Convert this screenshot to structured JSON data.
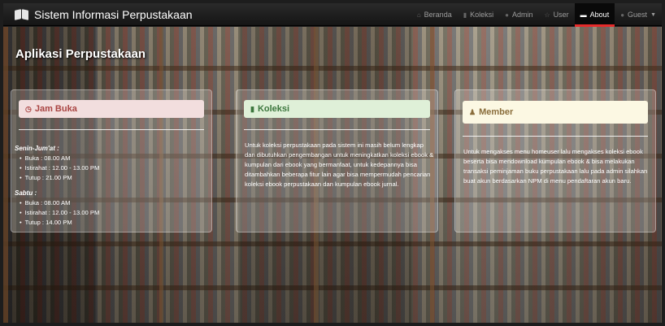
{
  "navbar": {
    "brand": "Sistem Informasi Perpustakaan",
    "items": [
      {
        "label": "Beranda",
        "icon": "home-icon",
        "glyph": "⌂",
        "active": false
      },
      {
        "label": "Koleksi",
        "icon": "book-icon",
        "glyph": "▮",
        "active": false
      },
      {
        "label": "Admin",
        "icon": "user-icon",
        "glyph": "●",
        "active": false
      },
      {
        "label": "User",
        "icon": "star-icon",
        "glyph": "☆",
        "active": false
      },
      {
        "label": "About",
        "icon": "briefcase-icon",
        "glyph": "▬",
        "active": true
      },
      {
        "label": "Guest",
        "icon": "user-icon",
        "glyph": "●",
        "active": false,
        "dropdown": true
      }
    ],
    "active_underline_color": "#e52a2a"
  },
  "hero": {
    "title": "Aplikasi Perpustakaan"
  },
  "cards": {
    "jam_buka": {
      "title": "Jam Buka",
      "icon": "clock-icon",
      "glyph": "◷",
      "groups": [
        {
          "title": "Senin-Jum'at :",
          "items": [
            "Buka : 08.00 AM",
            "Istirahat : 12.00 - 13.00 PM",
            "Tutup : 21.00 PM"
          ]
        },
        {
          "title": "Sabtu :",
          "items": [
            "Buka : 08.00 AM",
            "Istirahat : 12.00 - 13.00 PM",
            "Tutup : 14.00 PM"
          ]
        }
      ]
    },
    "koleksi": {
      "title": "Koleksi",
      "icon": "book-icon",
      "glyph": "▮",
      "text": "Untuk koleksi perpustakaan pada sistem ini masih belum lengkap dan dibutuhkan pengembangan untuk meningkatkan koleksi ebook & kumpulan dari ebook yang bermanfaat, untuk kedepannya bisa ditambahkan beberapa fitur lain agar bisa mempermudah pencarian koleksi ebook perpustakaan dan kumpulan ebook jurnal."
    },
    "member": {
      "title": "Member",
      "icon": "user-icon",
      "glyph": "♟",
      "text": "Untuk mengakses menu homeuser lalu mengakses koleksi ebook beserta bisa mendownload kumpulan ebook & bisa melakukan transaksi peminjaman buku perpustakaan lalu pada admin silahkan buat akun berdasarkan NPM di menu pendaftaran akun baru."
    }
  },
  "colors": {
    "danger_bg": "#f2dede",
    "success_bg": "#dff0d8",
    "warning_bg": "#fcf8e3"
  }
}
